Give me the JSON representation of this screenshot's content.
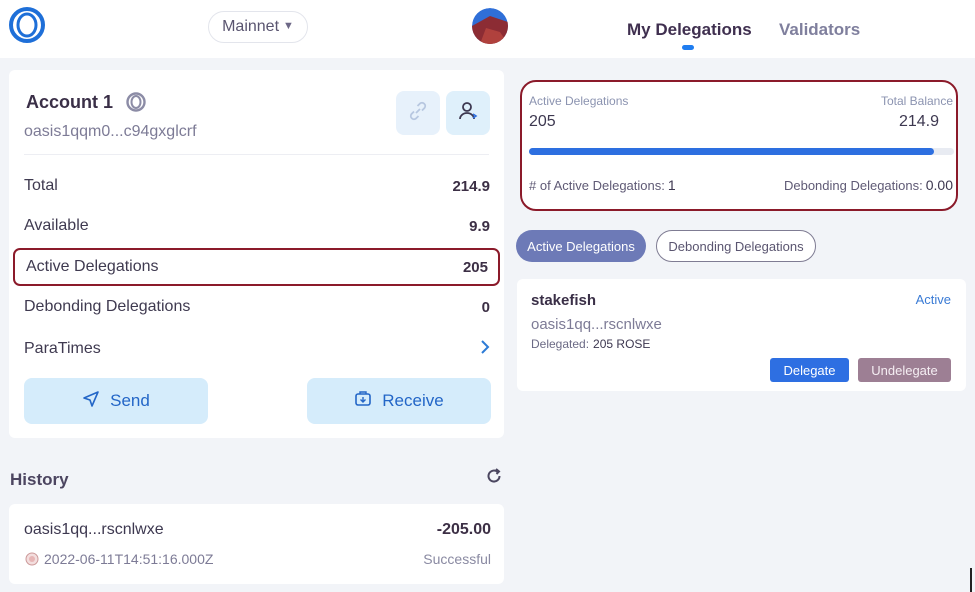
{
  "header": {
    "network": "Mainnet",
    "tabs": [
      {
        "label": "My Delegations",
        "active": true
      },
      {
        "label": "Validators",
        "active": false
      }
    ]
  },
  "account": {
    "name": "Account 1",
    "address": "oasis1qqm0...c94gxglcrf",
    "rows": {
      "total": {
        "label": "Total",
        "value": "214.9"
      },
      "available": {
        "label": "Available",
        "value": "9.9"
      },
      "active": {
        "label": "Active Delegations",
        "value": "205"
      },
      "debonding": {
        "label": "Debonding Delegations",
        "value": "0"
      },
      "paratimes": {
        "label": "ParaTimes"
      }
    },
    "send_label": "Send",
    "receive_label": "Receive"
  },
  "history": {
    "title": "History",
    "items": [
      {
        "address": "oasis1qq...rscnlwxe",
        "amount": "-205.00",
        "time": "2022-06-11T14:51:16.000Z",
        "status": "Successful"
      }
    ]
  },
  "summary": {
    "active_label": "Active Delegations",
    "active_value": "205",
    "balance_label": "Total Balance",
    "balance_value": "214.9",
    "progress_fraction": 0.954,
    "count_label": "# of Active Delegations:",
    "count_value": "1",
    "debonding_label": "Debonding Delegations:",
    "debonding_value": "0.00"
  },
  "filters": {
    "active": "Active Delegations",
    "debonding": "Debonding Delegations"
  },
  "delegation": {
    "name": "stakefish",
    "status": "Active",
    "address": "oasis1qq...rscnlwxe",
    "delegated_label": "Delegated:",
    "delegated_value": "205 ROSE",
    "delegate_btn": "Delegate",
    "undelegate_btn": "Undelegate"
  },
  "colors": {
    "accent": "#2d6fe0",
    "highlight_border": "#8b1a2a",
    "pill_active": "#6d7ab7",
    "undelegate": "#9d7f94"
  }
}
